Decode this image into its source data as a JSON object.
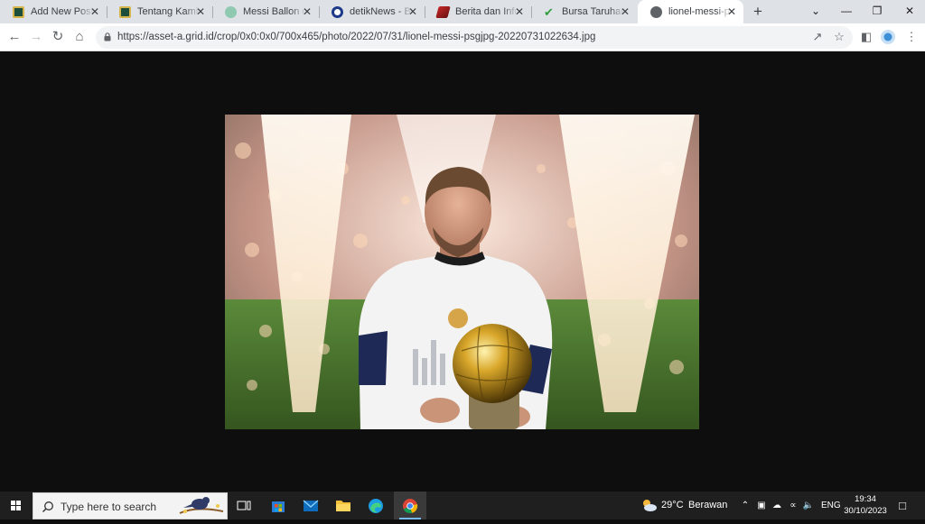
{
  "browser": {
    "tabs": [
      {
        "title": "Add New Post ‹",
        "favicon": "site-logo-icon",
        "active": false
      },
      {
        "title": "Tentang Kami - J",
        "favicon": "site-logo-icon",
        "active": false
      },
      {
        "title": "Messi Ballon d'O",
        "favicon": "globe-green-icon",
        "active": false
      },
      {
        "title": "detikNews - Beri",
        "favicon": "detik-icon",
        "active": false
      },
      {
        "title": "Berita dan Inform",
        "favicon": "news-icon",
        "active": false
      },
      {
        "title": "Bursa Taruhan Je",
        "favicon": "runner-icon",
        "active": false
      },
      {
        "title": "lionel-messi-psg",
        "favicon": "globe-icon",
        "active": true
      }
    ],
    "url": "https://asset-a.grid.id/crop/0x0:0x0/700x465/photo/2022/07/31/lionel-messi-psgjpg-20220731022634.jpg"
  },
  "image": {
    "description_alt": "lionel-messi-psgjpg-20220731022634.jpg"
  },
  "taskbar": {
    "search_placeholder": "Type here to search",
    "weather": {
      "temp": "29°C",
      "condition": "Berawan"
    },
    "language": "ENG",
    "time": "19:34",
    "date": "30/10/2023"
  },
  "colors": {
    "tabstrip": "#dee1e6",
    "page_background": "#0e0e0e",
    "taskbar": "#1f1f1f",
    "accent": "#76b9ed"
  }
}
